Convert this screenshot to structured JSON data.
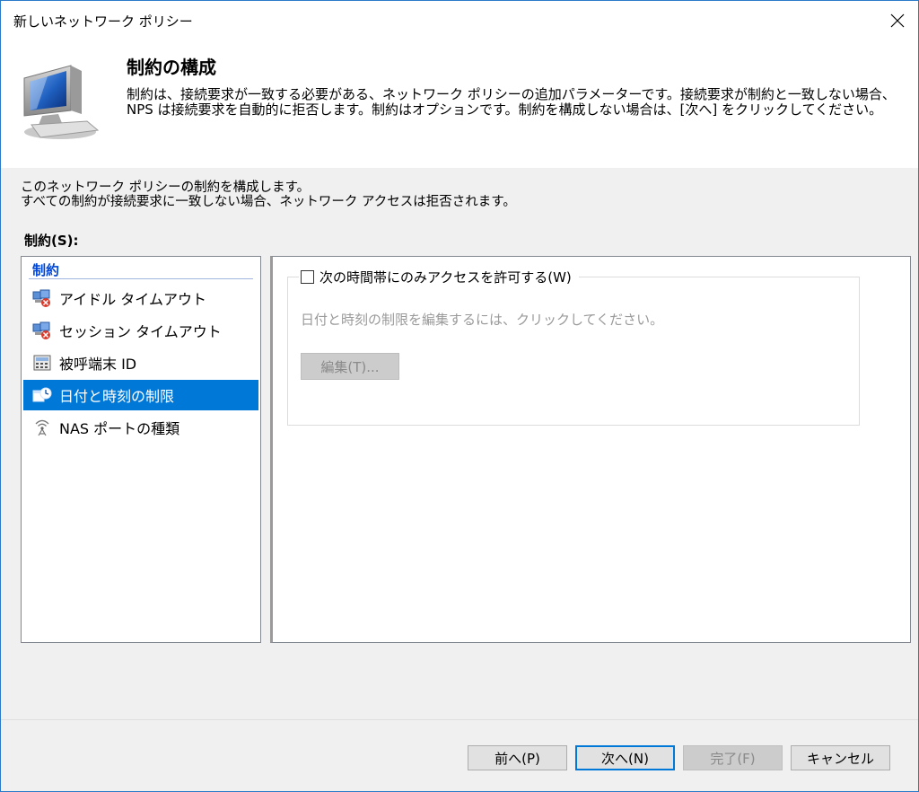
{
  "window": {
    "title": "新しいネットワーク ポリシー",
    "close_glyph": "✕"
  },
  "header": {
    "title": "制約の構成",
    "description": "制約は、接続要求が一致する必要がある、ネットワーク ポリシーの追加パラメーターです。接続要求が制約と一致しない場合、NPS は接続要求を自動的に拒否します。制約はオプションです。制約を構成しない場合は、[次へ] をクリックしてください。",
    "icon": "computer-monitor-icon"
  },
  "intro": {
    "line1": "このネットワーク ポリシーの制約を構成します。",
    "line2": "すべての制約が接続要求に一致しない場合、ネットワーク アクセスは拒否されます。"
  },
  "constraints_label": "制約(S):",
  "constraint_list": {
    "header": "制約",
    "items": [
      {
        "label": "アイドル タイムアウト",
        "icon": "idle-timeout-icon",
        "selected": false
      },
      {
        "label": "セッション タイムアウト",
        "icon": "session-timeout-icon",
        "selected": false
      },
      {
        "label": "被呼端末 ID",
        "icon": "called-station-id-icon",
        "selected": false
      },
      {
        "label": "日付と時刻の制限",
        "icon": "day-time-restriction-icon",
        "selected": true
      },
      {
        "label": "NAS ポートの種類",
        "icon": "nas-port-type-icon",
        "selected": false
      }
    ]
  },
  "detail": {
    "checkbox_label": "次の時間帯にのみアクセスを許可する(W)",
    "checkbox_checked": false,
    "help_text": "日付と時刻の制限を編集するには、クリックしてください。",
    "edit_button": "編集(T)..."
  },
  "footer": {
    "back": "前へ(P)",
    "next": "次へ(N)",
    "finish": "完了(F)",
    "cancel": "キャンセル"
  },
  "colors": {
    "selection": "#0078d7",
    "list_header": "#0046d5",
    "window_border": "#2b79c9"
  }
}
